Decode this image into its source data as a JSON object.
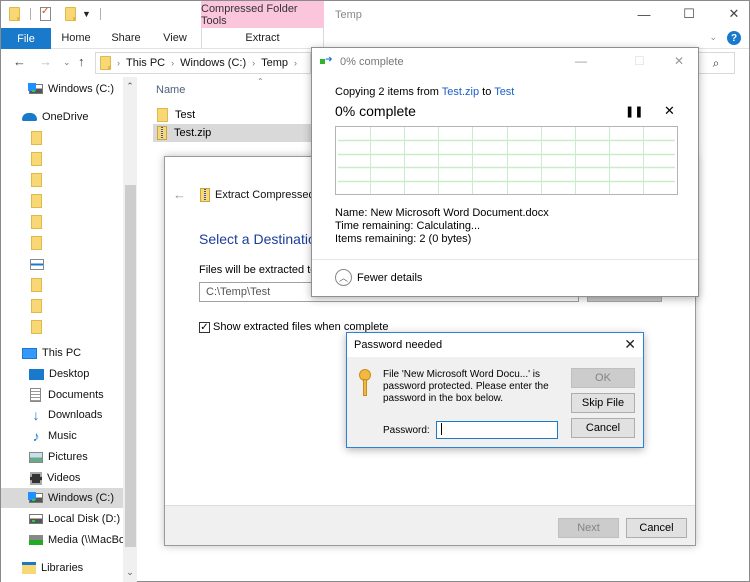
{
  "window": {
    "title": "Temp",
    "contextual_tab": "Compressed Folder Tools",
    "controls": {
      "minimize": "—",
      "maximize": "☐",
      "close": "✕"
    }
  },
  "quick_access": {
    "icons": [
      "folder-icon",
      "properties-icon",
      "new-folder-icon",
      "customize-dropdown-icon"
    ]
  },
  "ribbon": {
    "tabs": [
      {
        "label": "File",
        "active": true
      },
      {
        "label": "Home"
      },
      {
        "label": "Share"
      },
      {
        "label": "View"
      },
      {
        "label": "Extract"
      }
    ],
    "help_label": "?"
  },
  "navigation": {
    "back": "←",
    "forward": "→",
    "recent": "⌄",
    "up": "↑",
    "breadcrumb": [
      "This PC",
      "Windows (C:)",
      "Temp"
    ],
    "search_icon": "⌕"
  },
  "nav_pane": {
    "items": [
      {
        "label": "Windows (C:)",
        "icon": "drive-icon"
      },
      {
        "label": "OneDrive",
        "icon": "cloud-icon"
      },
      {
        "label": "",
        "icon": "folder-icon"
      },
      {
        "label": "",
        "icon": "folder-icon"
      },
      {
        "label": "",
        "icon": "folder-icon"
      },
      {
        "label": "",
        "icon": "folder-icon"
      },
      {
        "label": "",
        "icon": "folder-icon"
      },
      {
        "label": "",
        "icon": "folder-icon"
      },
      {
        "label": "",
        "icon": "shortcut-icon"
      },
      {
        "label": "",
        "icon": "folder-icon"
      },
      {
        "label": "",
        "icon": "folder-icon"
      },
      {
        "label": "",
        "icon": "folder-icon"
      },
      {
        "label": "This PC",
        "icon": "pc-icon"
      },
      {
        "label": "Desktop",
        "icon": "desktop-icon"
      },
      {
        "label": "Documents",
        "icon": "documents-icon"
      },
      {
        "label": "Downloads",
        "icon": "downloads-icon"
      },
      {
        "label": "Music",
        "icon": "music-icon"
      },
      {
        "label": "Pictures",
        "icon": "pictures-icon"
      },
      {
        "label": "Videos",
        "icon": "videos-icon"
      },
      {
        "label": "Windows (C:)",
        "icon": "drive-icon",
        "selected": true
      },
      {
        "label": "Local Disk (D:)",
        "icon": "drive-icon"
      },
      {
        "label": "Media (\\\\MacBo",
        "icon": "network-drive-icon"
      },
      {
        "label": "Libraries",
        "icon": "libraries-icon"
      }
    ]
  },
  "file_list": {
    "column_header": "Name",
    "files": [
      {
        "name": "Test",
        "type": "folder"
      },
      {
        "name": "Test.zip",
        "type": "zip",
        "selected": true
      }
    ]
  },
  "extract_wizard": {
    "title": "Extract Compressed (",
    "heading": "Select a Destination",
    "label": "Files will be extracted to t",
    "path_value": "C:\\Temp\\Test",
    "show_files_label": "Show extracted files when complete",
    "show_files_checked": true,
    "next_label": "Next",
    "cancel_label": "Cancel"
  },
  "copy_progress": {
    "title": "0% complete",
    "copying_prefix": "Copying 2 items from ",
    "source": "Test.zip",
    "to_word": " to ",
    "destination": "Test",
    "percent_label": "0% complete",
    "percent": 0,
    "pause_label": "❚❚",
    "stop_label": "✕",
    "name_label": "Name:",
    "name_value": "New Microsoft Word Document.docx",
    "time_label": "Time remaining:",
    "time_value": "Calculating...",
    "items_label": "Items remaining:",
    "items_value": "2 (0 bytes)",
    "fewer_details_label": "Fewer details",
    "grid_color": "#c9ecc9"
  },
  "password_dialog": {
    "title": "Password needed",
    "message": "File 'New Microsoft Word Docu...' is password protected.  Please enter the password in the box below.",
    "password_label": "Password:",
    "password_value": "",
    "ok_label": "OK",
    "skip_label": "Skip File",
    "cancel_label": "Cancel",
    "close_label": "✕"
  }
}
